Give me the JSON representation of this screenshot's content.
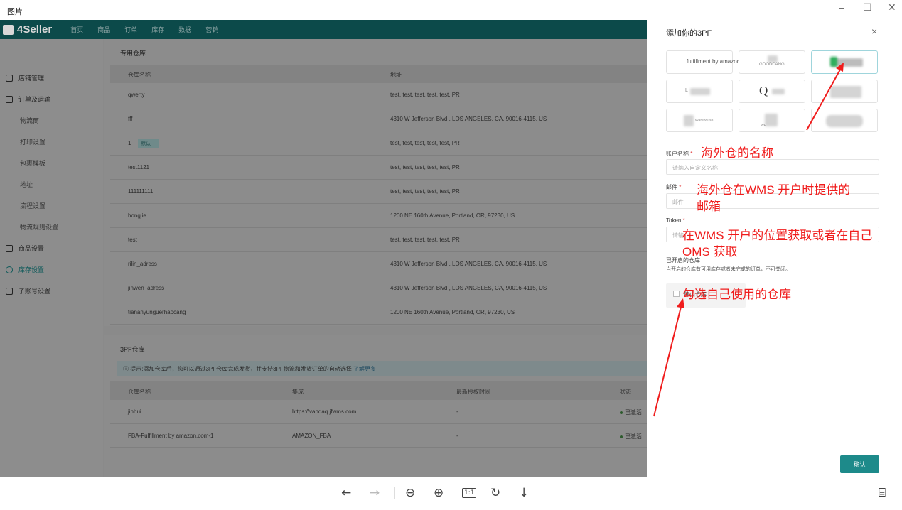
{
  "viewer": {
    "title": "图片"
  },
  "window": {
    "minimize": "–",
    "maximize": "☐",
    "close": "✕"
  },
  "app": {
    "logo": "4Seller",
    "nav": [
      "首页",
      "商品",
      "订单",
      "库存",
      "数据",
      "营销"
    ],
    "sidebar": [
      {
        "label": "店铺管理",
        "icon": "store-icon"
      },
      {
        "label": "订单及运输",
        "icon": "order-icon"
      },
      {
        "label": "物流商"
      },
      {
        "label": "打印设置"
      },
      {
        "label": "包裹模板"
      },
      {
        "label": "地址"
      },
      {
        "label": "流程设置"
      },
      {
        "label": "物流规则设置"
      },
      {
        "label": "商品设置",
        "icon": "product-icon"
      },
      {
        "label": "库存设置",
        "icon": "inventory-icon",
        "active": true
      },
      {
        "label": "子账号设置",
        "icon": "subaccount-icon"
      }
    ]
  },
  "own_wh": {
    "title": "专用仓库",
    "headers": [
      "仓库名称",
      "地址"
    ],
    "default_badge": "默认",
    "rows": [
      {
        "name": "qwerty",
        "address": "test, test, test, test, test, PR"
      },
      {
        "name": "fff",
        "address": "4310 W Jefferson Blvd , LOS ANGELES, CA, 90016-4115, US"
      },
      {
        "name": "1",
        "address": "test, test, test, test, test, PR",
        "default": true
      },
      {
        "name": "test1121",
        "address": "test, test, test, test, test, PR"
      },
      {
        "name": "111111111",
        "address": "test, test, test, test, test, PR"
      },
      {
        "name": "hongjie",
        "address": "1200 NE 160th Avenue, Portland, OR, 97230, US"
      },
      {
        "name": "test",
        "address": "test, test, test, test, test, PR"
      },
      {
        "name": "rilin_adress",
        "address": "4310 W Jefferson Blvd , LOS ANGELES, CA, 90016-4115, US"
      },
      {
        "name": "jinwen_adress",
        "address": "4310 W Jefferson Blvd , LOS ANGELES, CA, 90016-4115, US"
      },
      {
        "name": "tiananyunguerhaocang",
        "address": "1200 NE 160th Avenue, Portland, OR, 97230, US"
      }
    ]
  },
  "tpf": {
    "title": "3PF仓库",
    "tip": "提示:添加仓库后，您可以通过3PF仓库完成发货，并支持3PF物流和发货订单的自动选择",
    "tip_link": "了解更多",
    "headers": [
      "仓库名称",
      "集成",
      "最新授权时间",
      "状态"
    ],
    "rows": [
      {
        "name": "jinhui",
        "integration": "https://vandaq.jfwms.com",
        "time": "-",
        "status": "已激活"
      },
      {
        "name": "FBA-Fulfillment by amazon.com-1",
        "integration": "AMAZON_FBA",
        "time": "-",
        "status": "已激活"
      }
    ]
  },
  "panel": {
    "title": "添加你的3PF",
    "close": "×",
    "providers": [
      "fulfillment by amazon",
      "GOODCANG",
      "",
      "L",
      "Q",
      "",
      "Warehouse",
      "WE",
      ""
    ],
    "account_label": "账户名称",
    "account_placeholder": "请输入自定义名称",
    "email_label": "邮件",
    "email_placeholder": "邮件",
    "token_label": "Token",
    "token_placeholder": "请输",
    "enabled_label": "已开启的仓库",
    "enabled_hint": "当开启的仓库有可用库存或者未完成的订单，不可关闭。",
    "wh_checkbox_label": "佛山仓库",
    "confirm": "确认"
  },
  "annotations": {
    "account": "海外仓的名称",
    "email_1": "海外仓在WMS 开户时提供的",
    "email_2": "邮箱",
    "token_1": "在WMS 开户的位置获取或者在自己",
    "token_2": "OMS 获取",
    "warehouse": "勾选自己使用的仓库",
    "color": "#f01c1c"
  },
  "toolbar": {
    "prev": "←",
    "next": "→",
    "zoom_out": "⊖",
    "zoom_in": "⊕",
    "actual_size": "1:1",
    "rotate": "↻",
    "download": "↓",
    "ocr": "⌸"
  }
}
